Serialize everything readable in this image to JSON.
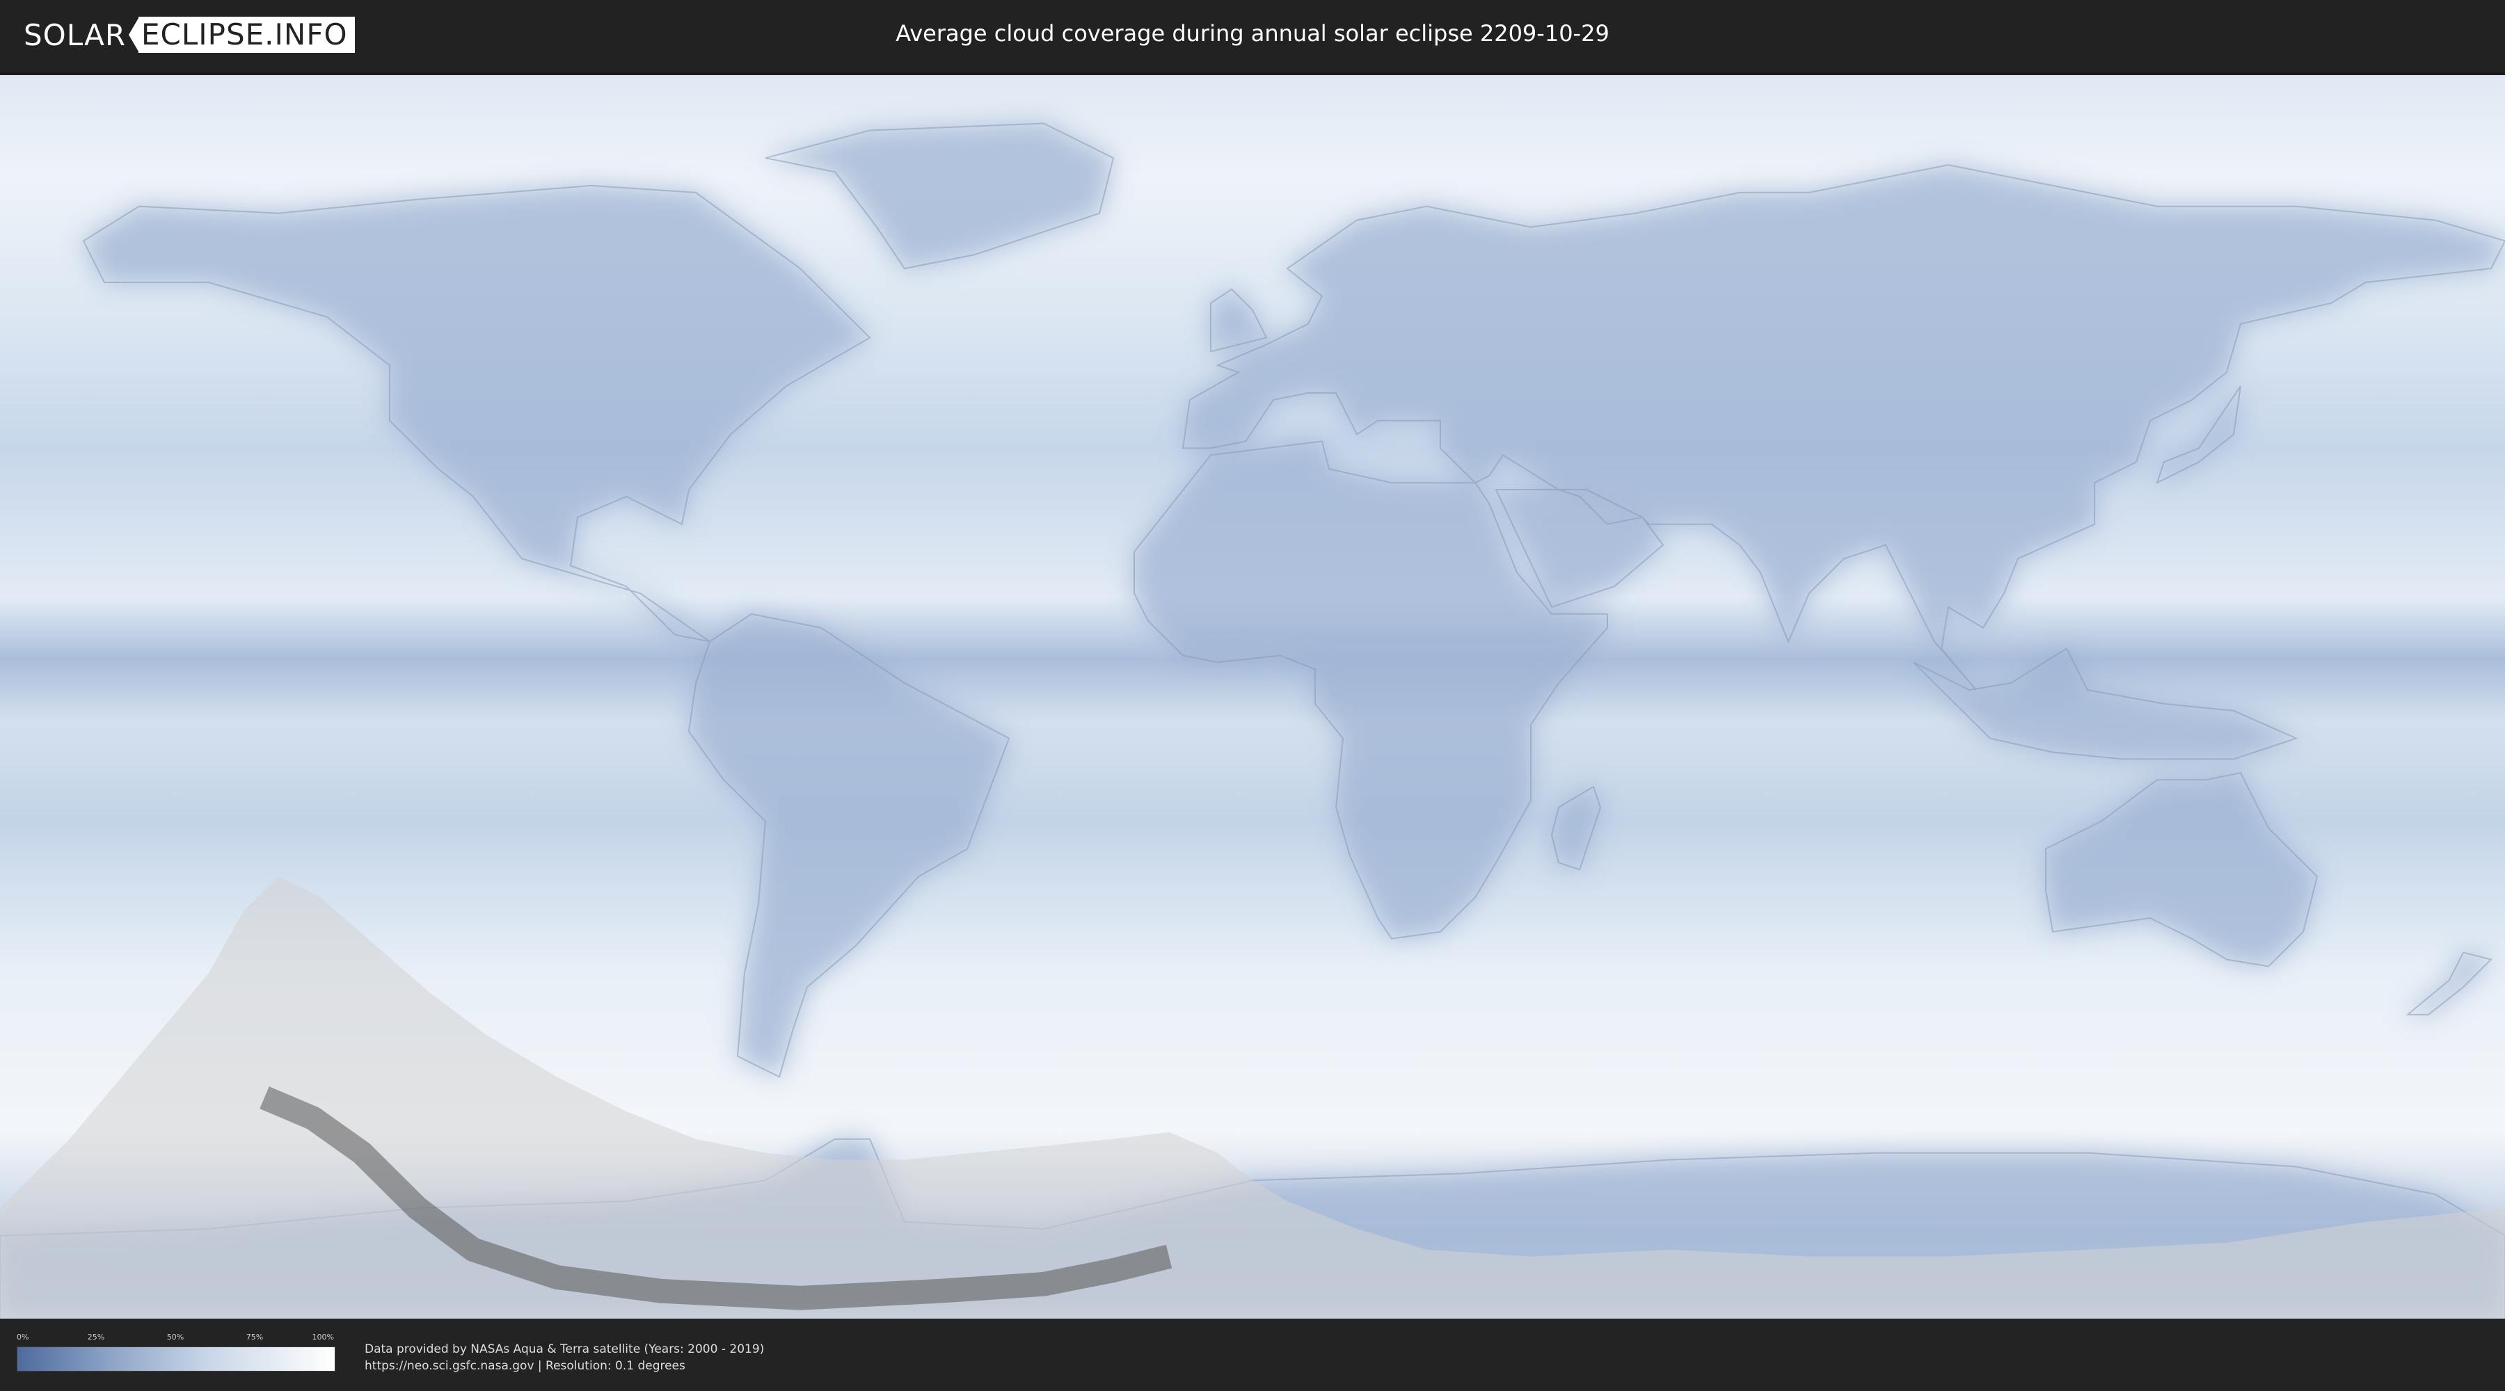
{
  "header": {
    "logo": {
      "solar_text": "SOLAR",
      "eclipse_text": "ECLIPSE.INFO"
    },
    "title": "Average cloud coverage during annual solar eclipse 2209-10-29"
  },
  "map": {
    "projection": "equirectangular",
    "extent": {
      "lon": [
        -180,
        180
      ],
      "lat": [
        -90,
        90
      ]
    },
    "colors": {
      "clear_sky": "#4e6b9e",
      "overcast": "#ffffff",
      "eclipse_overlay": "#d4d4d4",
      "central_path": "#5a5a5a"
    },
    "eclipse_penumbra": {
      "outline": [
        [
          -180,
          -74
        ],
        [
          -170,
          -64
        ],
        [
          -160,
          -52
        ],
        [
          -150,
          -40
        ],
        [
          -145,
          -31
        ],
        [
          -140,
          -26
        ],
        [
          -134,
          -29
        ],
        [
          -126,
          -36
        ],
        [
          -118,
          -43
        ],
        [
          -110,
          -49
        ],
        [
          -100,
          -55
        ],
        [
          -90,
          -60
        ],
        [
          -80,
          -64
        ],
        [
          -70,
          -66
        ],
        [
          -60,
          -67
        ],
        [
          -50,
          -67
        ],
        [
          -40,
          -66
        ],
        [
          -30,
          -65
        ],
        [
          -20,
          -64
        ],
        [
          -12,
          -63
        ],
        [
          -5,
          -66
        ],
        [
          0,
          -70
        ],
        [
          5,
          -73
        ],
        [
          15,
          -77
        ],
        [
          25,
          -80
        ],
        [
          40,
          -81
        ],
        [
          60,
          -80
        ],
        [
          80,
          -81
        ],
        [
          100,
          -81
        ],
        [
          120,
          -80
        ],
        [
          140,
          -79
        ],
        [
          160,
          -76
        ],
        [
          170,
          -75
        ],
        [
          180,
          -74
        ]
      ],
      "bottom_fill": [
        [
          -180,
          -90
        ],
        [
          180,
          -90
        ]
      ]
    },
    "central_path": {
      "center_line": [
        [
          -142,
          -58
        ],
        [
          -135,
          -61
        ],
        [
          -128,
          -66
        ],
        [
          -120,
          -74
        ],
        [
          -112,
          -80
        ],
        [
          -100,
          -84
        ],
        [
          -85,
          -86
        ],
        [
          -65,
          -87
        ],
        [
          -45,
          -86
        ],
        [
          -30,
          -85
        ],
        [
          -20,
          -83
        ],
        [
          -12,
          -81
        ]
      ],
      "width_deg": 3.5
    }
  },
  "legend": {
    "ticks": [
      "0%",
      "25%",
      "50%",
      "75%",
      "100%"
    ],
    "gradient": [
      "#4e6b9e",
      "#8fa5c8",
      "#c9d6e8",
      "#ffffff"
    ]
  },
  "credits": {
    "line1": "Data provided by NASAs Aqua & Terra satellite (Years: 2000 - 2019)",
    "line2": "https://neo.sci.gsfc.nasa.gov | Resolution: 0.1 degrees"
  }
}
